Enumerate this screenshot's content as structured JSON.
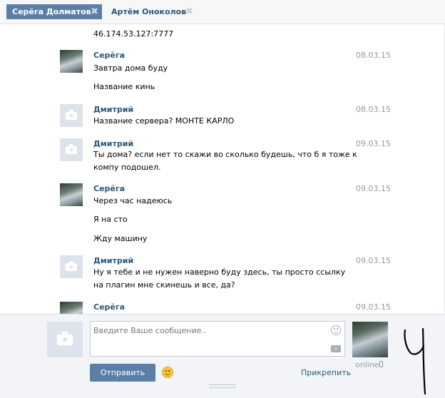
{
  "tabs": [
    {
      "label": "Серёга Долматов",
      "active": true
    },
    {
      "label": "Артём Оноколов",
      "active": false
    }
  ],
  "tab_close_glyph": "✖",
  "top_text": "46.174.53.127:7777",
  "messages": [
    {
      "author": "Серёга",
      "date": "08.03.15",
      "avatar": "photo",
      "lines": [
        "Завтра дома буду",
        "Название кинь"
      ]
    },
    {
      "author": "Дмитрий",
      "date": "08.03.15",
      "avatar": "blank",
      "lines": [
        "Название сервера? МОНТЕ КАРЛО"
      ]
    },
    {
      "author": "Дмитрий",
      "date": "09.03.15",
      "avatar": "blank",
      "lines": [
        "Ты дома? если нет то скажи во сколько будешь, что б я тоже к компу подошел."
      ]
    },
    {
      "author": "Серёга",
      "date": "09.03.15",
      "avatar": "photo",
      "lines": [
        "Через час надеюсь",
        "Я на сто",
        "Жду машину"
      ]
    },
    {
      "author": "Дмитрий",
      "date": "09.03.15",
      "avatar": "blank",
      "lines": [
        "Ну я тебе и не нужен наверно буду здесь, ты просто ссылку на плагин мне скинешь и все, да?"
      ]
    },
    {
      "author": "Серёга",
      "date": "09.03.15",
      "avatar": "photo",
      "lines": []
    }
  ],
  "composer": {
    "placeholder": "Введите Ваше сообщение..",
    "send_label": "Отправить",
    "attach_label": "Прикрепить",
    "online_label": "online"
  },
  "colors": {
    "accent": "#5b7fa6",
    "link": "#2b587a",
    "muted": "#999999"
  }
}
